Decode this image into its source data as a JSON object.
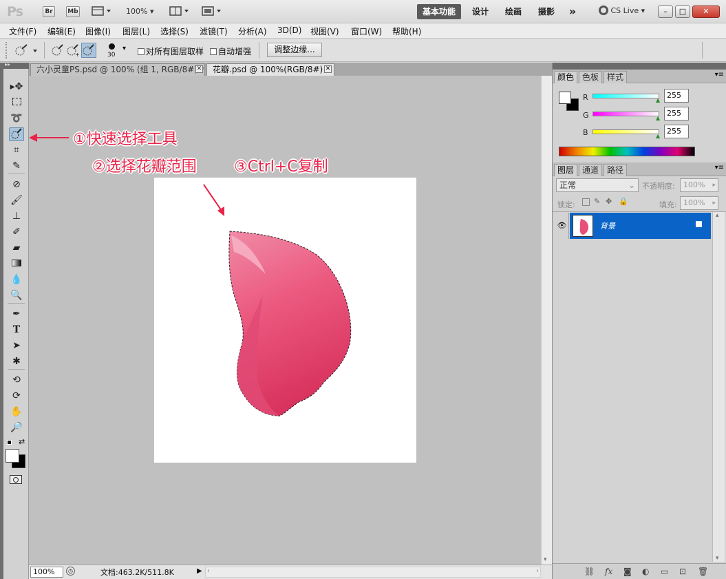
{
  "titlebar": {
    "app_logo": "Ps",
    "bridge_label": "Br",
    "minibridge_label": "Mb",
    "zoom_value": "100%",
    "workspaces": [
      "基本功能",
      "设计",
      "绘画",
      "摄影"
    ],
    "more": "»",
    "cs_live": "CS Live"
  },
  "menu": [
    "文件(F)",
    "编辑(E)",
    "图像(I)",
    "图层(L)",
    "选择(S)",
    "滤镜(T)",
    "分析(A)",
    "3D(D)",
    "视图(V)",
    "窗口(W)",
    "帮助(H)"
  ],
  "options": {
    "brush_size": "30",
    "sample_all_layers": "对所有图层取样",
    "auto_enhance": "自动增强",
    "refine_edge": "调整边缘..."
  },
  "tabs": [
    {
      "label": "六小灵童PS.psd @ 100% (组 1, RGB/8#) *"
    },
    {
      "label": "花瓣.psd @ 100%(RGB/8#) *"
    }
  ],
  "annotations": {
    "step1": "①快速选择工具",
    "step2": "②选择花瓣范围",
    "step3": "③Ctrl+C复制"
  },
  "status": {
    "zoom": "100%",
    "doc_size": "文档:463.2K/511.8K"
  },
  "color_panel": {
    "tabs": [
      "颜色",
      "色板",
      "样式"
    ],
    "channels": [
      {
        "label": "R",
        "value": "255"
      },
      {
        "label": "G",
        "value": "255"
      },
      {
        "label": "B",
        "value": "255"
      }
    ]
  },
  "layers_panel": {
    "tabs": [
      "图层",
      "通道",
      "路径"
    ],
    "blend_mode": "正常",
    "opacity_label": "不透明度:",
    "opacity_value": "100%",
    "lock_label": "锁定:",
    "fill_label": "填充:",
    "fill_value": "100%",
    "layer_name": "背景"
  }
}
